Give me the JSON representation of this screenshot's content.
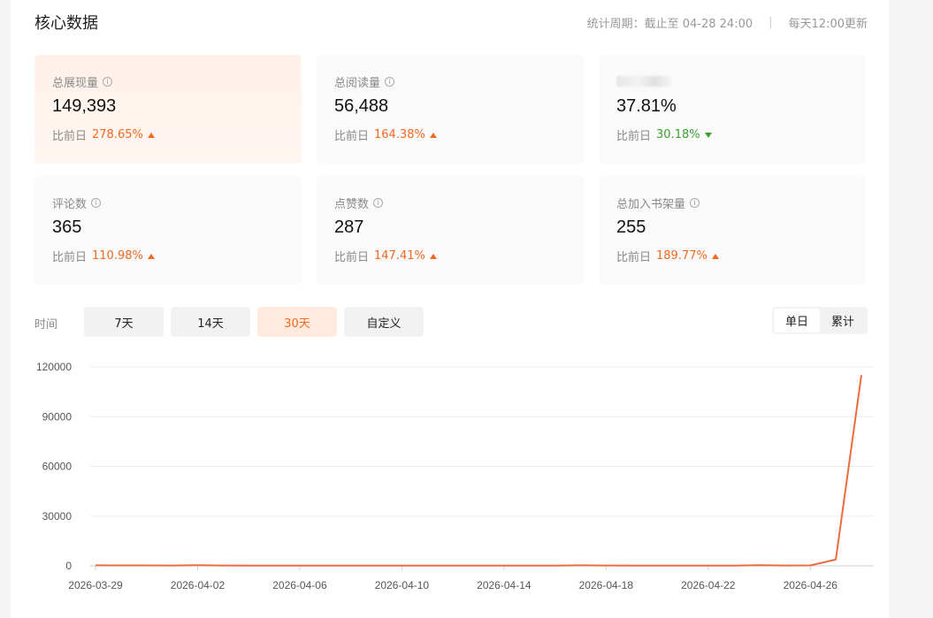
{
  "header": {
    "title": "核心数据",
    "period": "统计周期：截止至 04-28 24:00",
    "update": "每天12:00更新"
  },
  "cards": [
    {
      "label": "总展现量",
      "value": "149,393",
      "compare_label": "比前日",
      "pct": "278.65%",
      "trend": "up",
      "has_info": true
    },
    {
      "label": "总阅读量",
      "value": "56,488",
      "compare_label": "比前日",
      "pct": "164.38%",
      "trend": "up",
      "has_info": true
    },
    {
      "label": "",
      "value": "37.81%",
      "compare_label": "比前日",
      "pct": "30.18%",
      "trend": "down",
      "has_info": false
    },
    {
      "label": "评论数",
      "value": "365",
      "compare_label": "比前日",
      "pct": "110.98%",
      "trend": "up",
      "has_info": true
    },
    {
      "label": "点赞数",
      "value": "287",
      "compare_label": "比前日",
      "pct": "147.41%",
      "trend": "up",
      "has_info": true
    },
    {
      "label": "总加入书架量",
      "value": "255",
      "compare_label": "比前日",
      "pct": "189.77%",
      "trend": "up",
      "has_info": true
    }
  ],
  "time_filter": {
    "label": "时间",
    "options": [
      "7天",
      "14天",
      "30天",
      "自定义"
    ],
    "selected": "30天"
  },
  "view_toggle": {
    "options": [
      "单日",
      "累计"
    ],
    "selected": "单日"
  },
  "colors": {
    "accent": "#f26a21",
    "up": "#f26a21",
    "down": "#3aa02e",
    "line": "#ec6c3c"
  },
  "chart_data": {
    "type": "line",
    "x_ticks": [
      "2026-03-29",
      "2026-04-02",
      "2026-04-06",
      "2026-04-10",
      "2026-04-14",
      "2026-04-18",
      "2026-04-22",
      "2026-04-26"
    ],
    "y_ticks": [
      0,
      30000,
      60000,
      90000,
      120000
    ],
    "ylim": [
      0,
      120000
    ],
    "grid": true,
    "x": [
      "2026-03-29",
      "2026-03-30",
      "2026-03-31",
      "2026-04-01",
      "2026-04-02",
      "2026-04-03",
      "2026-04-04",
      "2026-04-05",
      "2026-04-06",
      "2026-04-07",
      "2026-04-08",
      "2026-04-09",
      "2026-04-10",
      "2026-04-11",
      "2026-04-12",
      "2026-04-13",
      "2026-04-14",
      "2026-04-15",
      "2026-04-16",
      "2026-04-17",
      "2026-04-18",
      "2026-04-19",
      "2026-04-20",
      "2026-04-21",
      "2026-04-22",
      "2026-04-23",
      "2026-04-24",
      "2026-04-25",
      "2026-04-26",
      "2026-04-27",
      "2026-04-28"
    ],
    "series": [
      {
        "values": [
          300,
          280,
          260,
          240,
          350,
          200,
          150,
          160,
          180,
          170,
          160,
          150,
          140,
          150,
          160,
          170,
          150,
          160,
          180,
          300,
          200,
          180,
          170,
          160,
          170,
          150,
          400,
          200,
          250,
          3800,
          115000
        ]
      }
    ]
  }
}
